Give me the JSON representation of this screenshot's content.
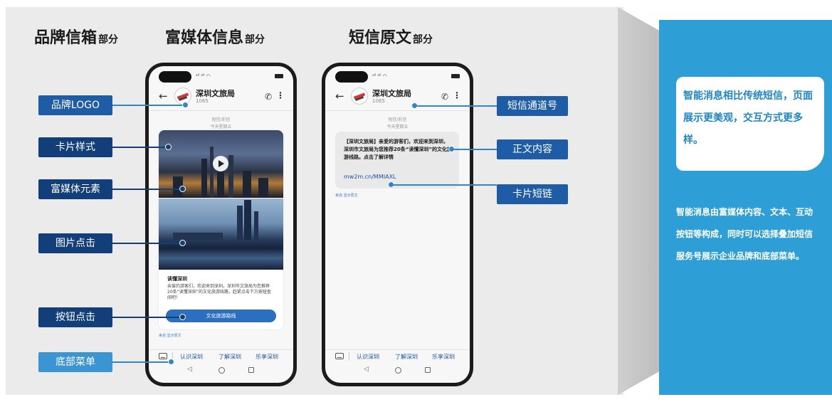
{
  "headings": {
    "brand_main": "品牌信箱",
    "brand_sub": "部分",
    "rich_main": "富媒体信息",
    "rich_sub": "部分",
    "sms_main": "短信原文",
    "sms_sub": "部分"
  },
  "left_labels": [
    "品牌LOGO",
    "卡片样式",
    "富媒体元素",
    "图片点击",
    "按钮点击",
    "底部菜单"
  ],
  "right_labels": [
    "短信通道号",
    "正文内容",
    "卡片短链"
  ],
  "phone": {
    "signal": "ᵃˡˡ ᵃˡˡ ◠",
    "sender_name": "深圳文旅局",
    "sender_number": "1065",
    "meta_type": "短信/彩信",
    "meta_date": "今天星期五",
    "back_symbol": "←",
    "call_symbol": "✆",
    "more_symbol": "⋮"
  },
  "rich_card": {
    "title": "读懂深圳",
    "description": "亲爱的游客们，欢迎来到深圳。深圳市文旅局为您推荐20条“读懂深圳”的文化旅游线路，赶紧点击下方按钮查阅吧！",
    "button": "文化旅游路线",
    "footnote": "来自 显示原文"
  },
  "sms": {
    "text": "【深圳文旅局】亲爱的游客们，欢迎来到深圳，深圳市文旅局为您推荐20条“读懂深圳”的文化旅游线路。点击了解详情",
    "link": "mw2m.cn/MMIAXL",
    "footnote": "来自 显示原文"
  },
  "bottom_menu": [
    "认识深圳",
    "了解深圳",
    "乐享深圳"
  ],
  "nav": {
    "back": "◁"
  },
  "side_panel": {
    "highlight": "智能消息相比传统短信，页面展示更美观，交互方式更多样。",
    "body": "智能消息由富媒体内容、文本、互动按钮等构成，同时可以选择叠加短信服务号展示企业品牌和底部菜单。"
  },
  "colors": {
    "label_blue": "#1f5ca6",
    "label_dark": "#123f7a",
    "panel_blue": "#2e9fd6",
    "link_blue": "#1c56a6"
  }
}
